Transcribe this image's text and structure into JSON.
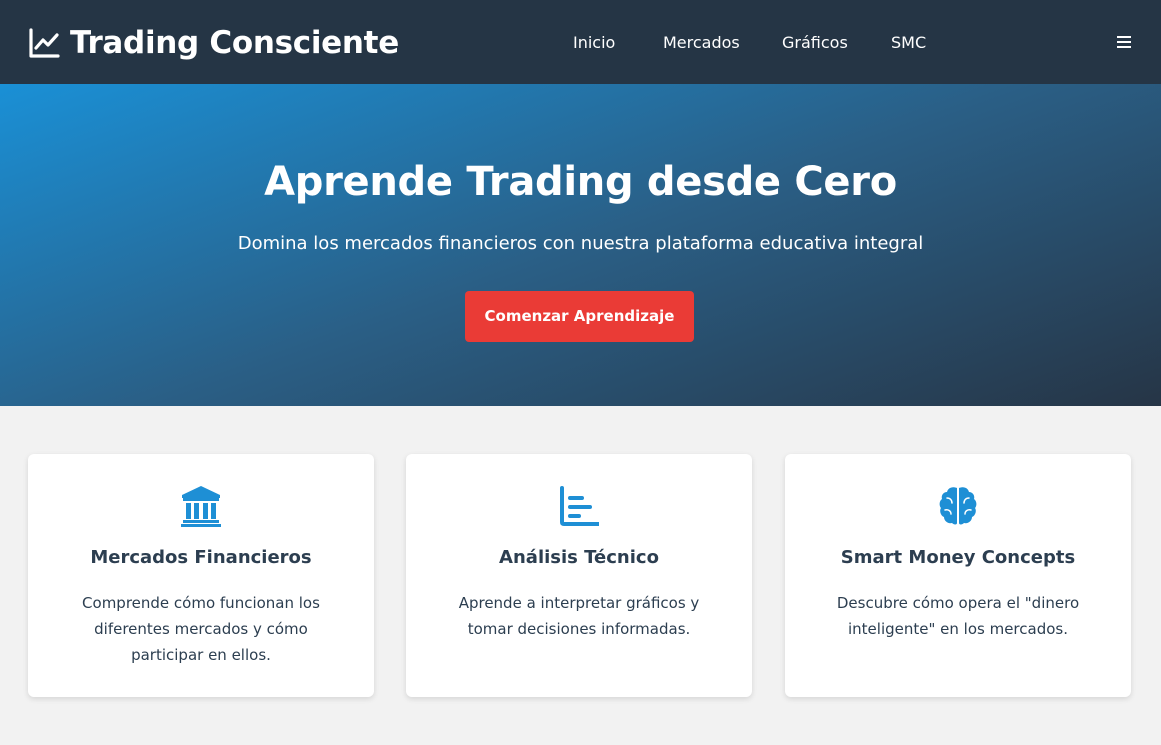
{
  "brand": {
    "icon": "chart-line-icon",
    "title": "Trading Consciente"
  },
  "nav": {
    "items": [
      {
        "label": "Inicio"
      },
      {
        "label": "Mercados"
      },
      {
        "label": "Gráficos"
      },
      {
        "label": "SMC"
      }
    ],
    "menu_icon": "hamburger-menu-icon"
  },
  "hero": {
    "title": "Aprende Trading desde Cero",
    "subtitle": "Domina los mercados financieros con nuestra plataforma educativa integral",
    "cta_label": "Comenzar Aprendizaje"
  },
  "features": [
    {
      "icon": "bank-icon",
      "title": "Mercados Financieros",
      "text": "Comprende cómo funcionan los diferentes mercados y cómo participar en ellos."
    },
    {
      "icon": "bar-chart-icon",
      "title": "Análisis Técnico",
      "text": "Aprende a interpretar gráficos y tomar decisiones informadas."
    },
    {
      "icon": "brain-icon",
      "title": "Smart Money Concepts",
      "text": "Descubre cómo opera el \"dinero inteligente\" en los mercados."
    }
  ],
  "colors": {
    "navbar": "#253545",
    "accent_blue": "#1a90d6",
    "cta_red": "#ea3b36",
    "page_bg": "#f2f2f2"
  }
}
